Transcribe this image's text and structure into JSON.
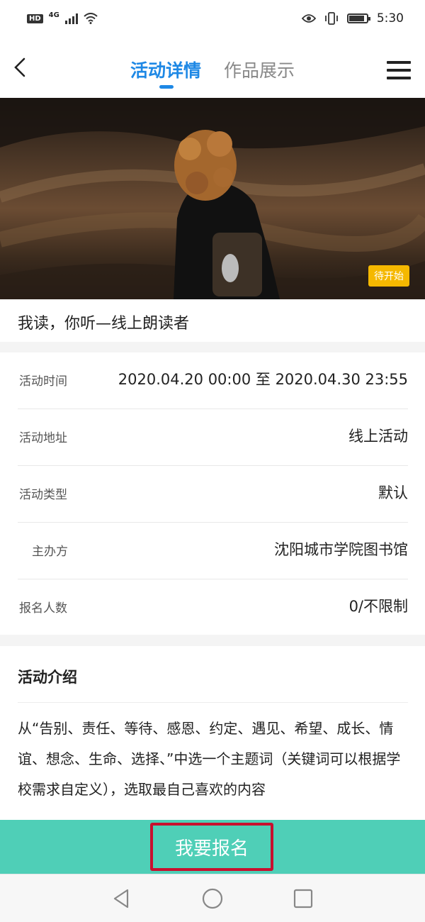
{
  "status_bar": {
    "hd_label": "HD",
    "network_label": "4G",
    "time": "5:30",
    "icons": [
      "hd-icon",
      "signal-icon",
      "wifi-icon",
      "eye-icon",
      "vibrate-icon",
      "battery-icon"
    ]
  },
  "header": {
    "tabs": [
      {
        "label": "活动详情",
        "active": true
      },
      {
        "label": "作品展示",
        "active": false
      }
    ],
    "back_icon": "chevron-left-icon",
    "menu_icon": "hamburger-menu-icon",
    "accent_color": "#1e88e5"
  },
  "hero": {
    "status_badge": "待开始",
    "badge_color": "#f5b800"
  },
  "activity": {
    "title": "我读，你听—线上朗读者"
  },
  "info": {
    "rows": [
      {
        "label": "活动时间",
        "value": "2020.04.20 00:00 至 2020.04.30 23:55"
      },
      {
        "label": "活动地址",
        "value": "线上活动"
      },
      {
        "label": "活动类型",
        "value": "默认"
      },
      {
        "label": "主办方",
        "value": "沈阳城市学院图书馆"
      },
      {
        "label": "报名人数",
        "value": "0/不限制"
      }
    ]
  },
  "intro": {
    "title": "活动介绍",
    "body": "从“告别、责任、等待、感恩、约定、遇见、希望、成长、情谊、想念、生命、选择、”中选一个主题词（关键词可以根据学校需求自定义），选取最自己喜欢的内容"
  },
  "signup": {
    "label": "我要报名",
    "bar_color": "#4fcfb7",
    "highlight_color": "#c8102e"
  },
  "nav_bar": {
    "icons": [
      "back-triangle-icon",
      "home-circle-icon",
      "recents-square-icon"
    ]
  }
}
